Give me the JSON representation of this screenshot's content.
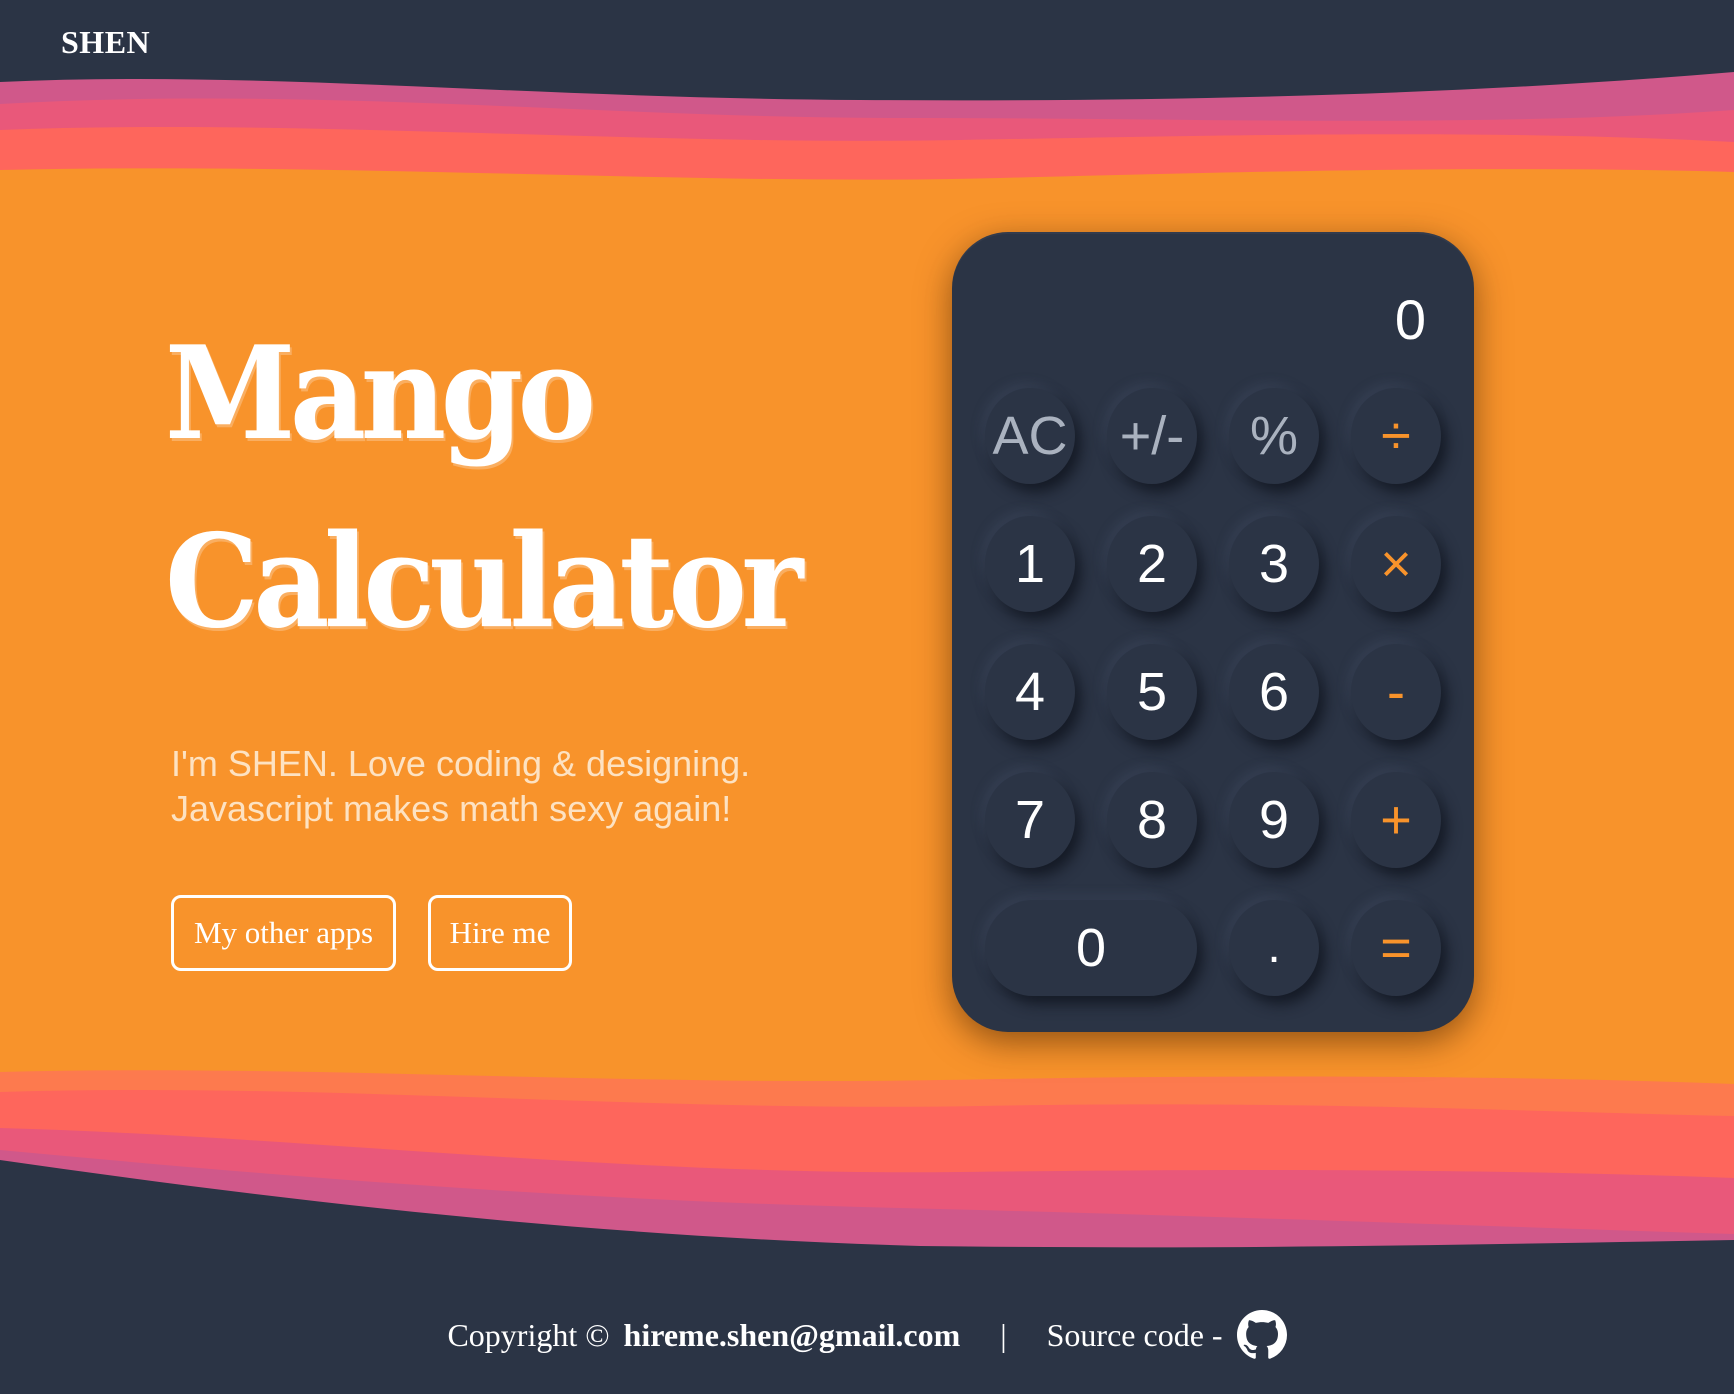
{
  "header": {
    "brand": "SHEN"
  },
  "hero": {
    "title_line1": "Mango",
    "title_line2": "Calculator",
    "tagline_line1": "I'm SHEN. Love coding & designing.",
    "tagline_line2": "Javascript makes math sexy again!",
    "buttons": {
      "apps": "My other apps",
      "hire": "Hire me"
    }
  },
  "calculator": {
    "display": "0",
    "keys": {
      "ac": "AC",
      "plusminus": "+/-",
      "percent": "%",
      "divide": "÷",
      "one": "1",
      "two": "2",
      "three": "3",
      "multiply": "×",
      "four": "4",
      "five": "5",
      "six": "6",
      "minus": "-",
      "seven": "7",
      "eight": "8",
      "nine": "9",
      "plus": "+",
      "zero": "0",
      "dot": ".",
      "equals": "="
    }
  },
  "footer": {
    "copyright": "Copyright ©",
    "email": "hireme.shen@gmail.com",
    "separator": "|",
    "source": "Source code -"
  },
  "colors": {
    "background_orange": "#f8932b",
    "navy": "#2b3445",
    "wave_coral": "#fe665c",
    "wave_pink": "#e9587a",
    "wave_magenta": "#d0588a",
    "operator_accent": "#f8932b"
  },
  "icons": {
    "github": "github-icon"
  }
}
